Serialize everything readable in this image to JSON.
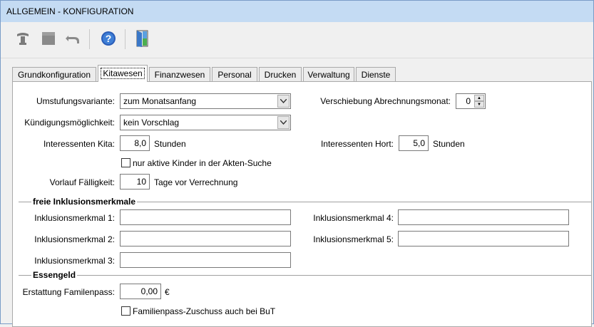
{
  "window": {
    "title": "ALLGEMEIN - KONFIGURATION"
  },
  "toolbar": {
    "buttons": [
      {
        "icon": "stamp-icon"
      },
      {
        "icon": "save-icon"
      },
      {
        "icon": "undo-icon"
      },
      {
        "icon": "help-icon"
      },
      {
        "icon": "exit-door-icon"
      }
    ]
  },
  "tabs": [
    "Grundkonfiguration",
    "Kitawesen",
    "Finanzwesen",
    "Personal",
    "Drucken",
    "Verwaltung",
    "Dienste"
  ],
  "active_tab": "Kitawesen",
  "form": {
    "umstufung_label": "Umstufungsvariante:",
    "umstufung_value": "zum Monatsanfang",
    "kuendigung_label": "Kündigungsmöglichkeit:",
    "kuendigung_value": "kein Vorschlag",
    "verschiebung_label": "Verschiebung Abrechnungsmonat:",
    "verschiebung_value": "0",
    "int_kita_label": "Interessenten Kita:",
    "int_kita_value": "8,0",
    "int_kita_unit": "Stunden",
    "int_hort_label": "Interessenten Hort:",
    "int_hort_value": "5,0",
    "int_hort_unit": "Stunden",
    "nur_aktive_label": "nur aktive Kinder in der Akten-Suche",
    "vorlauf_label": "Vorlauf Fälligkeit:",
    "vorlauf_value": "10",
    "vorlauf_unit": "Tage vor Verrechnung"
  },
  "inklusion": {
    "title": "freie Inklusionsmerkmale",
    "m1": "Inklusionsmerkmal 1:",
    "m2": "Inklusionsmerkmal 2:",
    "m3": "Inklusionsmerkmal 3:",
    "m4": "Inklusionsmerkmal 4:",
    "m5": "Inklusionsmerkmal 5:"
  },
  "essengeld": {
    "title": "Essengeld",
    "erstattung_label": "Erstattung Familenpass:",
    "erstattung_value": "0,00",
    "currency": "€",
    "zuschuss_label": "Familienpass-Zuschuss auch bei BuT"
  }
}
